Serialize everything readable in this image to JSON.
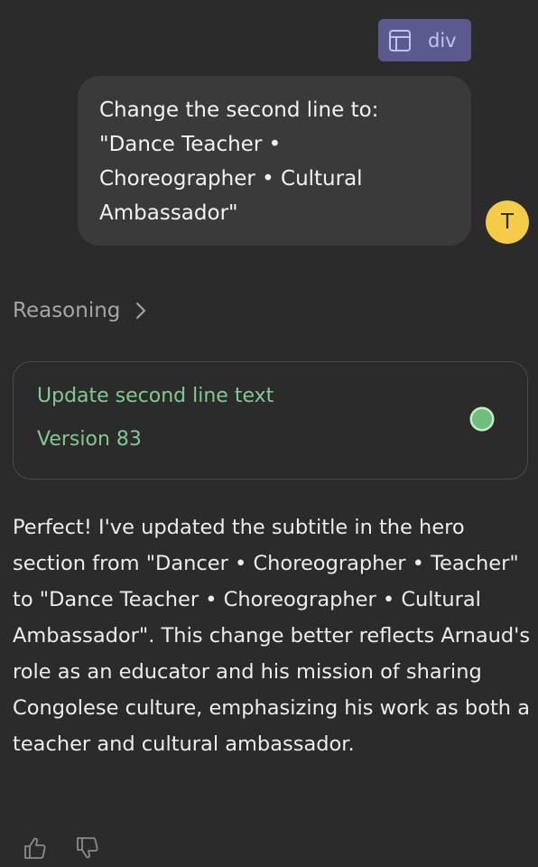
{
  "selector_tag": {
    "icon": "layout-icon",
    "label": "div"
  },
  "user_message": {
    "text": "Change the second line to:\n\"Dance Teacher •\nChoreographer • Cultural\nAmbassador\"",
    "avatar_initial": "T"
  },
  "reasoning": {
    "label": "Reasoning",
    "icon": "chevron-right-icon"
  },
  "version_card": {
    "title": "Update second line text",
    "version": "Version 83",
    "status_color": "#6fbf7a"
  },
  "assistant_message": {
    "text": "Perfect! I've updated the subtitle in the hero section from \"Dancer • Choreographer • Teacher\" to \"Dance Teacher • Choreographer • Cultural Ambassador\". This change better reflects Arnaud's role as an educator and his mission of sharing Congolese culture, emphasizing his work as both a teacher and cultural ambassador."
  },
  "feedback": {
    "like_icon": "thumbs-up-icon",
    "dislike_icon": "thumbs-down-icon"
  },
  "colors": {
    "background": "#2b2b2b",
    "accent_green": "#83c98f",
    "avatar": "#f5cc48",
    "tag_bg": "#5b5a8e"
  }
}
